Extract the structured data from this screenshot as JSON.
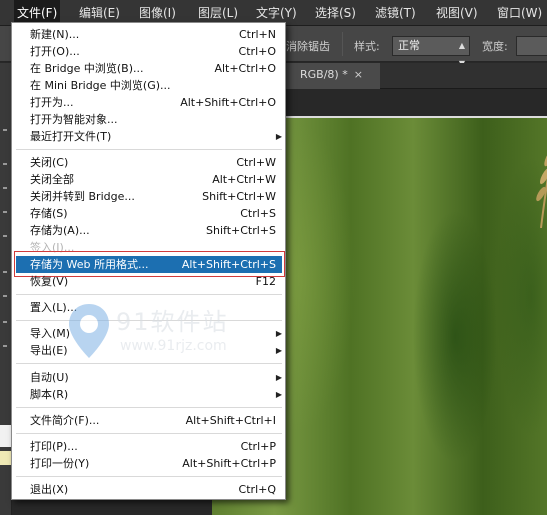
{
  "menubar": {
    "items": [
      "文件(F)",
      "编辑(E)",
      "图像(I)",
      "图层(L)",
      "文字(Y)",
      "选择(S)",
      "滤镜(T)",
      "视图(V)",
      "窗口(W)"
    ]
  },
  "options": {
    "antialias_label": "消除锯齿",
    "style_label": "样式:",
    "style_value": "正常",
    "width_label": "宽度:"
  },
  "document": {
    "tab_title": "RGB/8) *",
    "close_symbol": "×"
  },
  "watermark": {
    "name": "91软件站",
    "url": "www.91rjz.com"
  },
  "file_menu": {
    "items": [
      {
        "label": "新建(N)...",
        "shortcut": "Ctrl+N"
      },
      {
        "label": "打开(O)...",
        "shortcut": "Ctrl+O"
      },
      {
        "label": "在 Bridge 中浏览(B)...",
        "shortcut": "Alt+Ctrl+O"
      },
      {
        "label": "在 Mini Bridge 中浏览(G)...",
        "shortcut": ""
      },
      {
        "label": "打开为...",
        "shortcut": "Alt+Shift+Ctrl+O"
      },
      {
        "label": "打开为智能对象...",
        "shortcut": ""
      },
      {
        "label": "最近打开文件(T)",
        "shortcut": ""
      },
      {
        "label": "关闭(C)",
        "shortcut": "Ctrl+W"
      },
      {
        "label": "关闭全部",
        "shortcut": "Alt+Ctrl+W"
      },
      {
        "label": "关闭并转到 Bridge...",
        "shortcut": "Shift+Ctrl+W"
      },
      {
        "label": "存储(S)",
        "shortcut": "Ctrl+S"
      },
      {
        "label": "存储为(A)...",
        "shortcut": "Shift+Ctrl+S"
      },
      {
        "label": "签入(I)...",
        "shortcut": ""
      },
      {
        "label": "存储为 Web 所用格式...",
        "shortcut": "Alt+Shift+Ctrl+S"
      },
      {
        "label": "恢复(V)",
        "shortcut": "F12"
      },
      {
        "label": "置入(L)...",
        "shortcut": ""
      },
      {
        "label": "导入(M)",
        "shortcut": ""
      },
      {
        "label": "导出(E)",
        "shortcut": ""
      },
      {
        "label": "自动(U)",
        "shortcut": ""
      },
      {
        "label": "脚本(R)",
        "shortcut": ""
      },
      {
        "label": "文件简介(F)...",
        "shortcut": "Alt+Shift+Ctrl+I"
      },
      {
        "label": "打印(P)...",
        "shortcut": "Ctrl+P"
      },
      {
        "label": "打印一份(Y)",
        "shortcut": "Alt+Shift+Ctrl+P"
      },
      {
        "label": "退出(X)",
        "shortcut": "Ctrl+Q"
      }
    ]
  },
  "colors": {
    "menu_highlight": "#1c6fb1",
    "highlight_border": "#d13b3b"
  },
  "icons": {
    "submenu": "submenu-arrow-icon",
    "dropdown": "dropdown-arrow-icon"
  }
}
